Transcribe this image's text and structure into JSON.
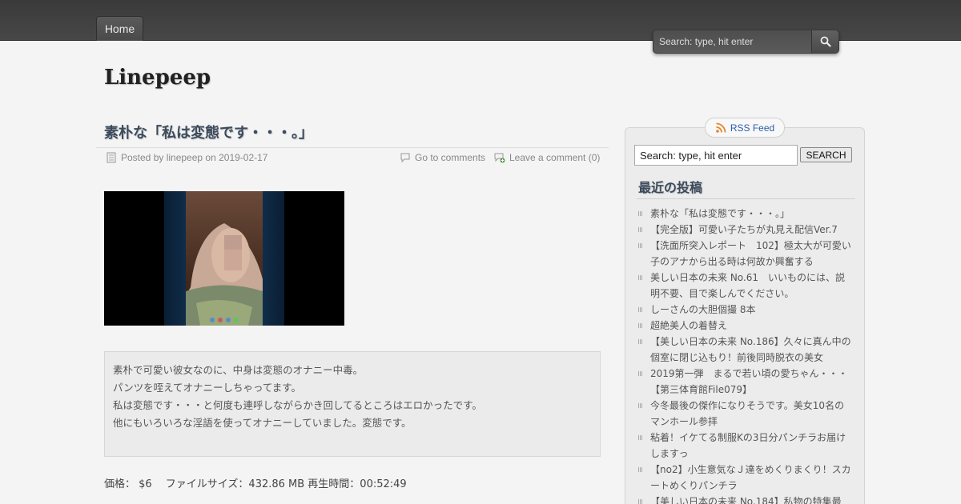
{
  "nav": {
    "home_label": "Home"
  },
  "top_search": {
    "placeholder": "Search: type, hit enter"
  },
  "site": {
    "title": "Linepeep"
  },
  "post": {
    "title": "素朴な「私は変態です・・・。」",
    "meta_posted": "Posted by linepeep on 2019-02-17",
    "meta_comments": "Go to comments",
    "meta_leave": "Leave a comment (0)",
    "excerpt_lines": [
      "素朴で可愛い彼女なのに、中身は変態のオナニー中毒。",
      "パンツを咥えてオナニーしちゃってます。",
      "私は変態です・・・と何度も連呼しながらかき回してるところはエロかったです。",
      "他にもいろいろな淫語を使ってオナニーしていました。変態です。"
    ],
    "price_line": "価格： $6　 ファイルサイズ：432.86 MB 再生時間：00:52:49"
  },
  "sidebar": {
    "rss_label": "RSS Feed",
    "search_value": "Search: type, hit enter",
    "search_button": "SEARCH",
    "recent_heading": "最近の投稿",
    "recent_posts": [
      "素朴な「私は変態です・・・。」",
      "【完全版】可愛い子たちが丸見え配信Ver.7",
      "【洗面所突入レポート　102】極太大が可愛い子のアナから出る時は何故か興奮する",
      "美しい日本の未来 No.61　いいものには、説明不要、目で楽しんでください。",
      "しーさんの大胆個撮 8本",
      "超絶美人の着替え",
      "【美しい日本の未来 No.186】久々に真ん中の個室に閉じ込もり！前後同時脱衣の美女",
      "2019第一弾　まるで若い頃の愛ちゃん・・・【第三体育館File079】",
      "今冬最後の傑作になりそうです。美女10名のマンホール参拝",
      "粘着！イケてる制服Kの3日分パンチラお届けしますっ",
      "【no2】小生意気なＪ達をめくりまくり！スカートめくりパンチラ",
      "【美しい日本の未来 No.184】私物の特集最"
    ]
  },
  "colors": {
    "topbar": "#404040",
    "title_blue": "#3c4a5c",
    "rss_blue": "#2b5ea8"
  }
}
